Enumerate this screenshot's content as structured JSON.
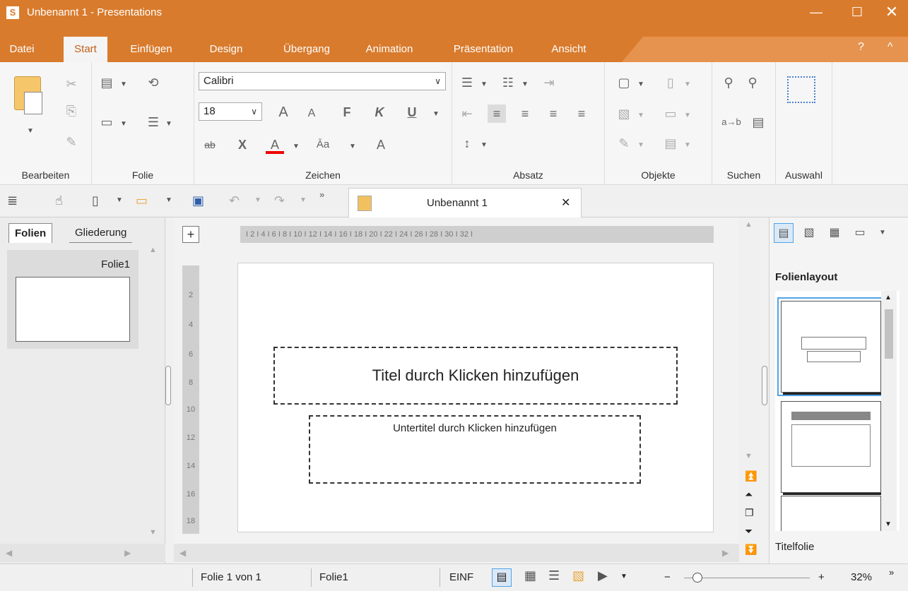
{
  "window": {
    "app_letter": "S",
    "title": "Unbenannt 1 - Presentations",
    "min": "—",
    "max": "☐",
    "close": "✕"
  },
  "menu": {
    "tabs": [
      "Datei",
      "Start",
      "Einfügen",
      "Design",
      "Übergang",
      "Animation",
      "Präsentation",
      "Ansicht"
    ],
    "active": "Start",
    "help": "?",
    "collapse": "^"
  },
  "ribbon": {
    "groups": [
      "Bearbeiten",
      "Folie",
      "Zeichen",
      "Absatz",
      "Objekte",
      "Suchen",
      "Auswahl"
    ],
    "font_name": "Calibri",
    "font_size": "18",
    "buttons": {
      "grow": "A",
      "shrink": "A",
      "bold": "F",
      "italic": "K",
      "underline": "U",
      "strike": "ab",
      "clear": "X",
      "color": "A",
      "case": "Āa",
      "replace": "a→b"
    }
  },
  "doc_tab": {
    "label": "Unbenannt 1",
    "close": "✕"
  },
  "left_pane": {
    "tabs": [
      "Folien",
      "Gliederung"
    ],
    "slide_label": "Folie1"
  },
  "editor": {
    "ruler_text": "I  2  I  4  I  6  I  8  I  10  I  12  I  14  I  16  I  18  I  20  I  22  I  24  I  26  I  28  I  30  I  32  I",
    "vruler_marks": [
      "2",
      "4",
      "6",
      "8",
      "10",
      "12",
      "14",
      "16",
      "18"
    ],
    "title_placeholder": "Titel durch Klicken hinzufügen",
    "subtitle_placeholder": "Untertitel durch Klicken hinzufügen"
  },
  "right_pane": {
    "heading": "Folienlayout",
    "selected_layout": "Titelfolie"
  },
  "status": {
    "slide_pos": "Folie 1 von 1",
    "slide_name": "Folie1",
    "mode": "EINF",
    "zoom_minus": "−",
    "zoom_plus": "+",
    "zoom": "32%",
    "more": "»"
  },
  "colors": {
    "accent": "#d97b2d",
    "selection": "#4fa3e8"
  }
}
